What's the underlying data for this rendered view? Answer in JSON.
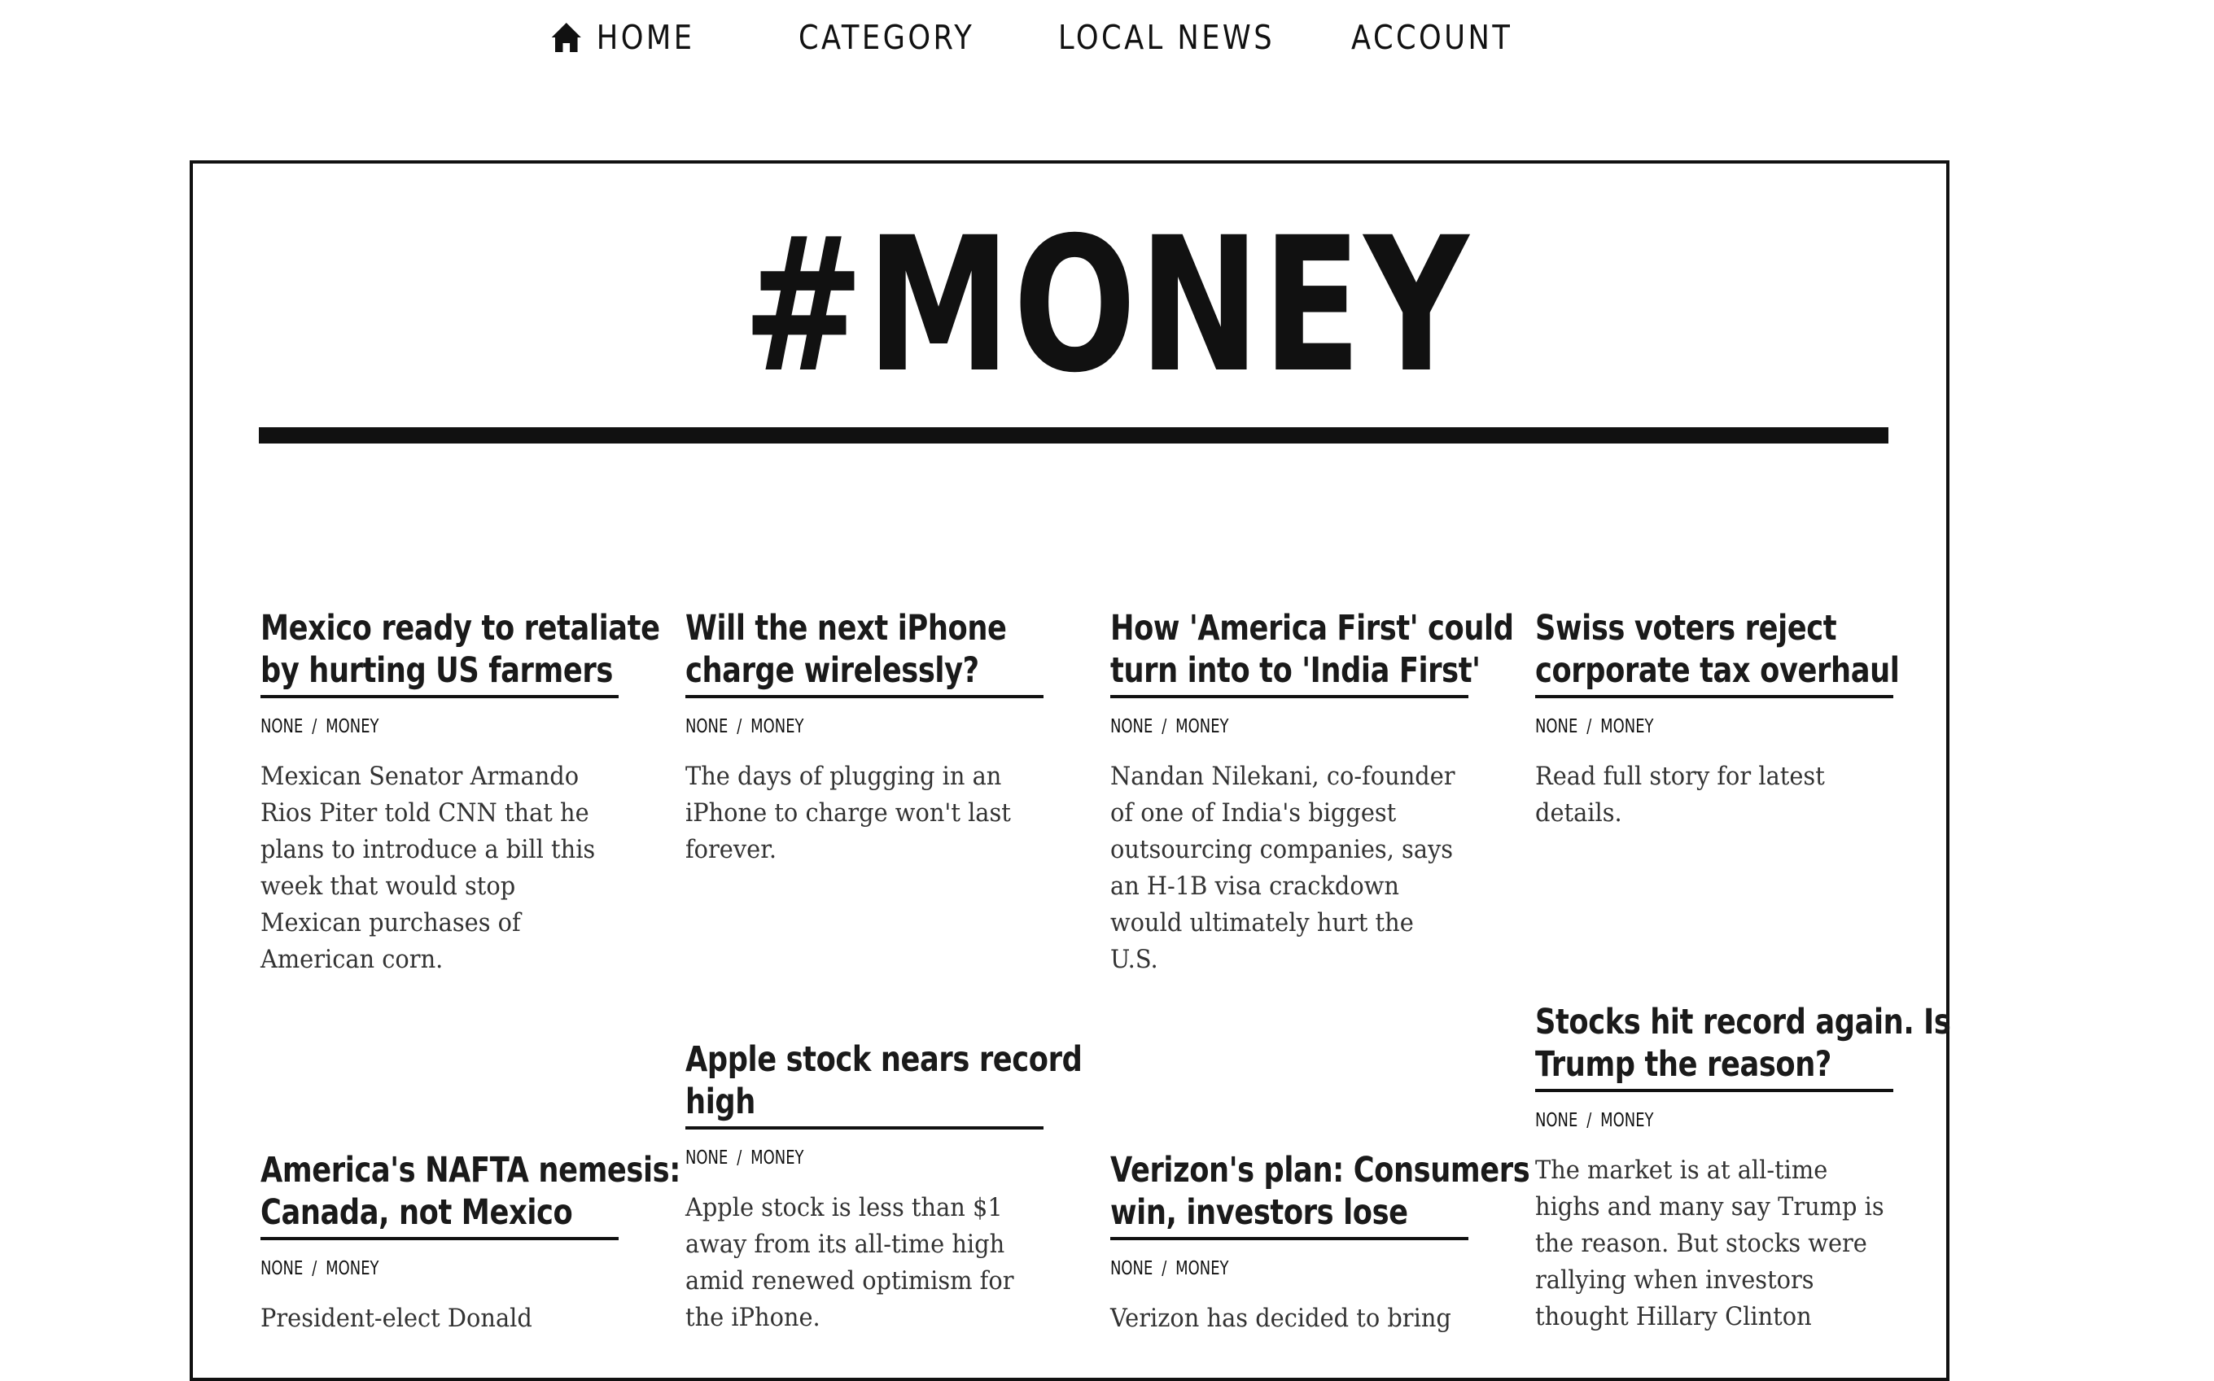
{
  "nav": {
    "items": [
      {
        "label": "HOME",
        "icon": "home-icon"
      },
      {
        "label": "CATEGORY"
      },
      {
        "label": "LOCAL NEWS"
      },
      {
        "label": "ACCOUNT"
      }
    ]
  },
  "page": {
    "title": "#MONEY"
  },
  "articles": [
    {
      "headline": [
        "Mexico ready to retaliate",
        "by hurting US farmers"
      ],
      "author": "NONE",
      "category": "MONEY",
      "excerpt": [
        "Mexican Senator Armando",
        "Rios Piter told CNN that he",
        "plans to introduce a bill this",
        "week that would stop",
        "Mexican purchases of",
        "American corn."
      ]
    },
    {
      "headline": [
        "Will the next iPhone",
        "charge wirelessly?"
      ],
      "author": "NONE",
      "category": "MONEY",
      "excerpt": [
        "The days of plugging in an",
        "iPhone to charge won't last",
        "forever."
      ]
    },
    {
      "headline": [
        "How 'America First' could",
        "turn into to 'India First'"
      ],
      "author": "NONE",
      "category": "MONEY",
      "excerpt": [
        "Nandan Nilekani, co-founder",
        "of one of India's biggest",
        "outsourcing companies, says",
        "an H-1B visa crackdown",
        "would ultimately hurt the",
        "U.S."
      ]
    },
    {
      "headline": [
        "Swiss voters reject",
        "corporate tax overhaul"
      ],
      "author": "NONE",
      "category": "MONEY",
      "excerpt": [
        "Read full story for latest",
        "details."
      ]
    },
    {
      "headline": [
        "Apple stock nears record",
        "high"
      ],
      "author": "NONE",
      "category": "MONEY",
      "excerpt": [
        "Apple stock is less than $1",
        "away from its all-time high",
        "amid renewed optimism for",
        "the iPhone."
      ]
    },
    {
      "headline": [
        "Stocks hit record again. Is",
        "Trump the reason?"
      ],
      "author": "NONE",
      "category": "MONEY",
      "excerpt": [
        "The market is at all-time",
        "highs and many say Trump is",
        "the reason. But stocks were",
        "rallying when investors",
        "thought Hillary Clinton"
      ]
    },
    {
      "headline": [
        "America's NAFTA nemesis:",
        "Canada, not Mexico"
      ],
      "author": "NONE",
      "category": "MONEY",
      "excerpt": [
        "President-elect Donald"
      ]
    },
    {
      "headline": [
        "Verizon's plan: Consumers",
        "win, investors lose"
      ],
      "author": "NONE",
      "category": "MONEY",
      "excerpt": [
        "Verizon has decided to bring"
      ]
    }
  ]
}
